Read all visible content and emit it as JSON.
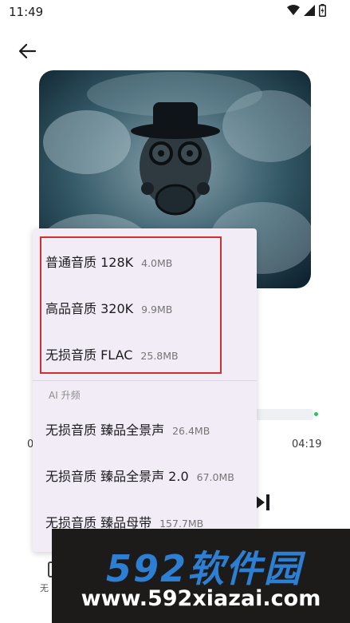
{
  "status_bar": {
    "time": "11:49",
    "icons": [
      "wifi-icon",
      "signal-icon",
      "battery-icon"
    ]
  },
  "header": {
    "back_icon": "arrow-left-icon"
  },
  "player": {
    "time_elapsed": "0",
    "time_total": "04:19",
    "next_icon": "skip-next-icon",
    "bottom_label": "无"
  },
  "quality_menu": {
    "standard_items": [
      {
        "name": "普通音质 128K",
        "size": "4.0MB"
      },
      {
        "name": "高品音质 320K",
        "size": "9.9MB"
      },
      {
        "name": "无损音质 FLAC",
        "size": "25.8MB"
      }
    ],
    "ai_section_label": "AI 升频",
    "ai_items": [
      {
        "name": "无损音质 臻品全景声",
        "size": "26.4MB"
      },
      {
        "name": "无损音质 臻品全景声 2.0",
        "size": "67.0MB"
      },
      {
        "name": "无损音质 臻品母带",
        "size": "157.7MB"
      }
    ]
  },
  "watermark": {
    "brand": "592软件园",
    "url": "www.592xiazai.com"
  },
  "colors": {
    "highlight": "#d32f2f",
    "menu_bg": "#f2ecf6",
    "progress_dot": "#2ec05c",
    "watermark_brand": "#2d7fd3"
  }
}
